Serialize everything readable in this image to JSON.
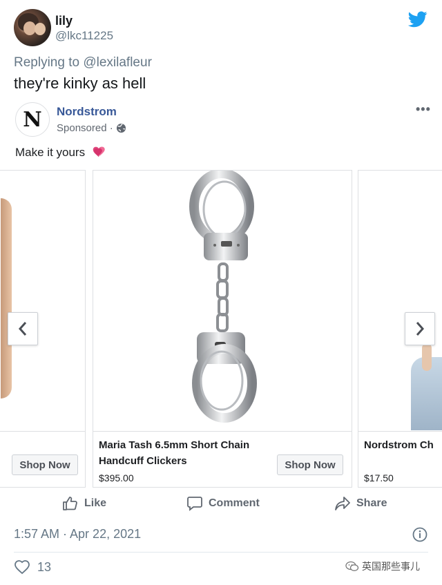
{
  "tweet": {
    "display_name": "lily",
    "handle": "@lkc11225",
    "replying_prefix": "Replying to",
    "replying_to": "@lexilafleur",
    "text": "they're kinky as hell",
    "timestamp": "1:57 AM · Apr 22, 2021",
    "like_count": "13",
    "brand_color": "#1da1f2"
  },
  "ad": {
    "page_name": "Nordstrom",
    "logo_letter": "N",
    "sponsored_label": "Sponsored ·",
    "caption": "Make it yours",
    "caption_emoji": "two-hearts-icon",
    "more_label": "•••",
    "cards": [
      {
        "title": "",
        "price": "",
        "cta": "Shop Now"
      },
      {
        "title_line1": "Maria Tash 6.5mm Short Chain",
        "title_line2": "Handcuff Clickers",
        "price": "$395.00",
        "cta": "Shop Now"
      },
      {
        "title": "Nordstrom Ch",
        "price": "$17.50"
      }
    ],
    "actions": {
      "like": "Like",
      "comment": "Comment",
      "share": "Share"
    },
    "link_color": "#385898"
  },
  "watermark": {
    "text": "英国那些事儿",
    "icon": "wechat-icon"
  }
}
